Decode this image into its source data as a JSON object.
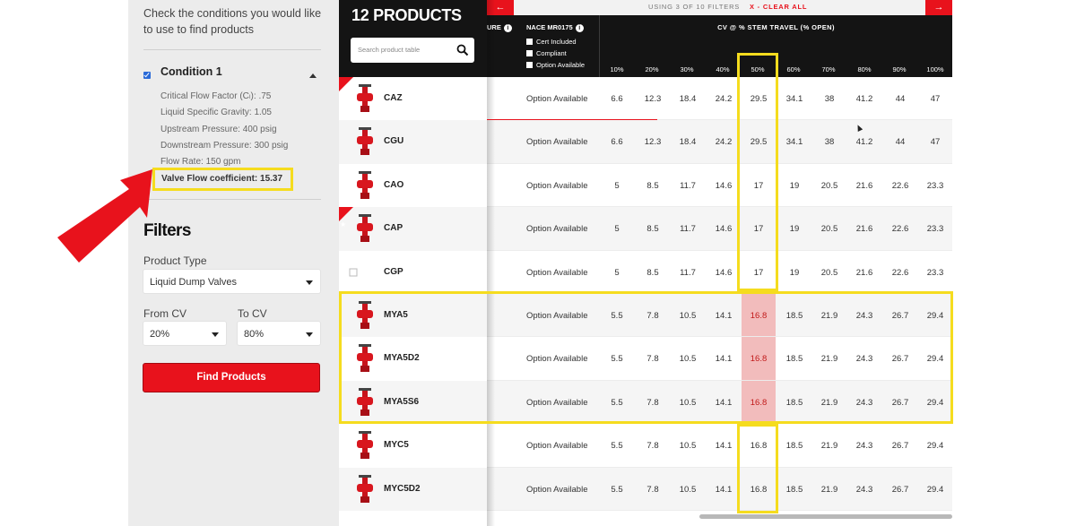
{
  "sidebar": {
    "intro": "Check the conditions you would like to use to find products",
    "condition_title": "Condition 1",
    "params": [
      "Critical Flow Factor (Cₗ): .75",
      "Liquid Specific Gravity: 1.05",
      "Upstream Pressure: 400 psig",
      "Downstream Pressure: 300 psig",
      "Flow Rate: 150 gpm"
    ],
    "valve_flow": "Valve Flow coefficient: 15.37",
    "filters_title": "Filters",
    "product_type_label": "Product Type",
    "product_type_value": "Liquid Dump Valves",
    "from_cv_label": "From CV",
    "from_cv_value": "20%",
    "to_cv_label": "To CV",
    "to_cv_value": "80%",
    "find_button": "Find Products"
  },
  "header": {
    "title": "12 PRODUCTS",
    "search_placeholder": "Search product table",
    "filter_status": "USING 3 OF 10 FILTERS",
    "clear_all": "X - CLEAR ALL",
    "col_ure": "URE",
    "col_nace": "NACE MR0175",
    "nace_options": [
      "Cert Included",
      "Compliant",
      "Option Available"
    ],
    "col_cv": "CV @ % STEM TRAVEL (% OPEN)",
    "percents": [
      "10%",
      "20%",
      "30%",
      "40%",
      "50%",
      "60%",
      "70%",
      "80%",
      "90%",
      "100%"
    ]
  },
  "rows": [
    {
      "name": "CAZ",
      "nace": "Option Available",
      "values": [
        "6.6",
        "12.3",
        "18.4",
        "24.2",
        "29.5",
        "34.1",
        "38",
        "41.2",
        "44",
        "47"
      ]
    },
    {
      "name": "CGU",
      "nace": "Option Available",
      "values": [
        "6.6",
        "12.3",
        "18.4",
        "24.2",
        "29.5",
        "34.1",
        "38",
        "41.2",
        "44",
        "47"
      ]
    },
    {
      "name": "CAO",
      "nace": "Option Available",
      "values": [
        "5",
        "8.5",
        "11.7",
        "14.6",
        "17",
        "19",
        "20.5",
        "21.6",
        "22.6",
        "23.3"
      ]
    },
    {
      "name": "CAP",
      "nace": "Option Available",
      "values": [
        "5",
        "8.5",
        "11.7",
        "14.6",
        "17",
        "19",
        "20.5",
        "21.6",
        "22.6",
        "23.3"
      ]
    },
    {
      "name": "CGP",
      "nace": "Option Available",
      "values": [
        "5",
        "8.5",
        "11.7",
        "14.6",
        "17",
        "19",
        "20.5",
        "21.6",
        "22.6",
        "23.3"
      ]
    },
    {
      "name": "MYA5",
      "nace": "Option Available",
      "values": [
        "5.5",
        "7.8",
        "10.5",
        "14.1",
        "16.8",
        "18.5",
        "21.9",
        "24.3",
        "26.7",
        "29.4"
      ]
    },
    {
      "name": "MYA5D2",
      "nace": "Option Available",
      "values": [
        "5.5",
        "7.8",
        "10.5",
        "14.1",
        "16.8",
        "18.5",
        "21.9",
        "24.3",
        "26.7",
        "29.4"
      ]
    },
    {
      "name": "MYA5S6",
      "nace": "Option Available",
      "values": [
        "5.5",
        "7.8",
        "10.5",
        "14.1",
        "16.8",
        "18.5",
        "21.9",
        "24.3",
        "26.7",
        "29.4"
      ]
    },
    {
      "name": "MYC5",
      "nace": "Option Available",
      "values": [
        "5.5",
        "7.8",
        "10.5",
        "14.1",
        "16.8",
        "18.5",
        "21.9",
        "24.3",
        "26.7",
        "29.4"
      ]
    },
    {
      "name": "MYC5D2",
      "nace": "Option Available",
      "values": [
        "5.5",
        "7.8",
        "10.5",
        "14.1",
        "16.8",
        "18.5",
        "21.9",
        "24.3",
        "26.7",
        "29.4"
      ]
    }
  ],
  "colors": {
    "accent_red": "#e8121c",
    "highlight_yellow": "#f5dc1e",
    "header_dark": "#141414",
    "cell_highlight": "#f2bcbc"
  }
}
